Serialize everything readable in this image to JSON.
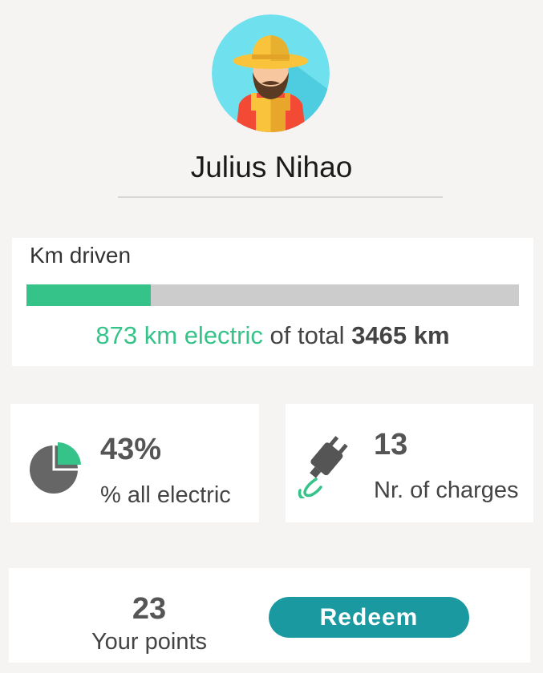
{
  "profile": {
    "name": "Julius Nihao",
    "avatar_icon": "farmer-avatar-icon"
  },
  "km_driven": {
    "title": "Km driven",
    "electric_fraction": 0.252,
    "electric_text": "873 km electric",
    "middle_text": " of total ",
    "total_text": "3465 km",
    "colors": {
      "electric": "#36c389",
      "track": "#cccccc"
    }
  },
  "stats": {
    "electric_percent": {
      "value": "43%",
      "label": "% all electric",
      "icon": "pie-chart-icon"
    },
    "charges": {
      "value": "13",
      "label": "Nr. of charges",
      "icon": "plug-icon"
    }
  },
  "points": {
    "value": "23",
    "label": "Your points",
    "redeem_label": "Redeem",
    "accent": "#1a9aa0"
  }
}
